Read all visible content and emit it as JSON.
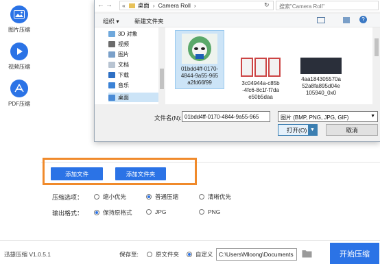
{
  "sidebar": {
    "items": [
      {
        "label": "图片压缩",
        "icon": "image-icon"
      },
      {
        "label": "视频压缩",
        "icon": "play-icon"
      },
      {
        "label": "PDF压缩",
        "icon": "pdf-icon"
      }
    ]
  },
  "dialog": {
    "breadcrumb": [
      "«",
      "桌面",
      "›",
      "Camera Roll",
      "›"
    ],
    "search_placeholder": "搜索\"Camera Roll\"",
    "toolbar": {
      "organize": "组织 ▾",
      "new_folder": "新建文件夹"
    },
    "tree": [
      {
        "label": "3D 对象"
      },
      {
        "label": "视频"
      },
      {
        "label": "图片"
      },
      {
        "label": "文档"
      },
      {
        "label": "下载"
      },
      {
        "label": "音乐"
      },
      {
        "label": "桌面",
        "selected": true
      }
    ],
    "files": [
      {
        "name": "01bdd4ff-0170-4844-9a55-965a2fd66f99",
        "lines": [
          "01bdd4ff-0170-",
          "4844-9a55-965",
          "a2fd66f99"
        ],
        "selected": true
      },
      {
        "name": "3c04944a-c85b-4fc6-8c1f-f7dae50b5daa",
        "lines": [
          "3c04944a-c85b",
          "-4fc6-8c1f-f7da",
          "e50b5daa"
        ]
      },
      {
        "name": "4aa184305570a52a8fa895d04e105940_0x0",
        "lines": [
          "4aa184305570a",
          "52a8fa895d04e",
          "105940_0x0"
        ]
      }
    ],
    "filename_label": "文件名(N):",
    "filename_value": "01bdd4ff-0170-4844-9a55-965",
    "filetype_value": "图片 (BMP, PNG, JPG, GIF)",
    "open_label": "打开(O)",
    "cancel_label": "取消"
  },
  "main": {
    "add_file_label": "添加文件",
    "add_folder_label": "添加文件夹",
    "compress_option_label": "压缩选项：",
    "compress_options": [
      {
        "label": "缩小优先",
        "selected": false
      },
      {
        "label": "普通压缩",
        "selected": true
      },
      {
        "label": "清晰优先",
        "selected": false
      }
    ],
    "output_format_label": "输出格式：",
    "output_formats": [
      {
        "label": "保持原格式",
        "selected": true
      },
      {
        "label": "JPG",
        "selected": false
      },
      {
        "label": "PNG",
        "selected": false
      }
    ],
    "accent_color": "#2b73e6",
    "highlight_color": "#f08a2b"
  },
  "footer": {
    "version": "迅捷压缩 V1.0.5.1",
    "save_to_label": "保存至:",
    "save_options": [
      {
        "label": "原文件夹",
        "selected": false
      },
      {
        "label": "自定义",
        "selected": true
      }
    ],
    "path_value": "C:\\Users\\Mloong\\Documents",
    "start_label": "开始压缩"
  }
}
